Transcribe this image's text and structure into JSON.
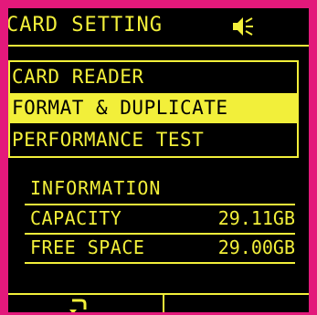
{
  "header": {
    "title": "CARD SETTING",
    "sound_icon": "speaker-muted-icon"
  },
  "menu": {
    "items": [
      {
        "label": "CARD READER",
        "selected": false
      },
      {
        "label": "FORMAT & DUPLICATE",
        "selected": true
      },
      {
        "label": "PERFORMANCE TEST",
        "selected": false
      }
    ]
  },
  "information": {
    "title": "INFORMATION",
    "rows": [
      {
        "label": "CAPACITY",
        "value": "29.11GB"
      },
      {
        "label": "FREE SPACE",
        "value": "29.00GB"
      }
    ]
  },
  "footer": {
    "back_icon": "return-arrow-icon"
  },
  "colors": {
    "bezel": "#e3197b",
    "screen_bg": "#000000",
    "text": "#f2ef3a"
  }
}
